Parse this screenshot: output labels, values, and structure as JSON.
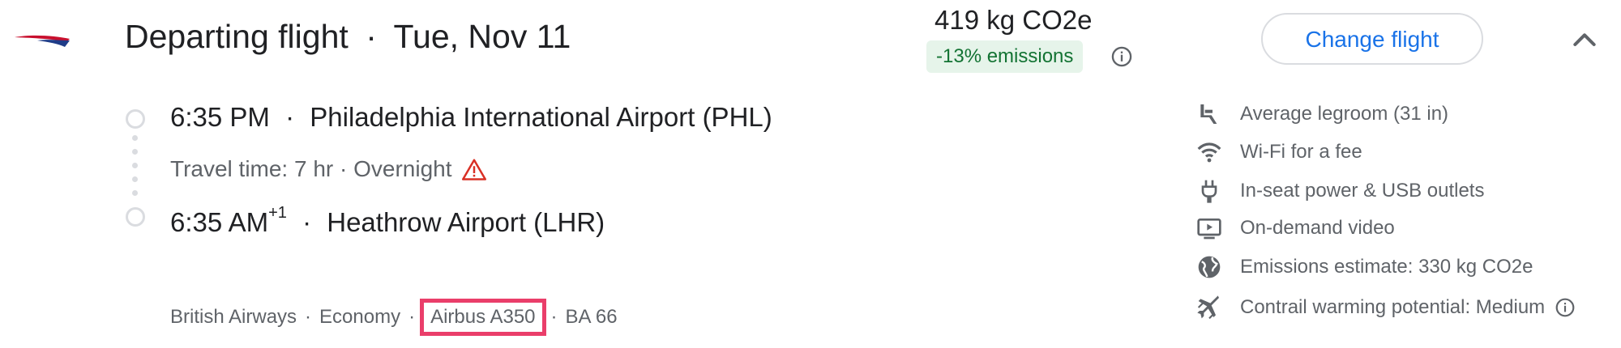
{
  "colors": {
    "accent": "#1a73e8",
    "emissions_bg": "#e6f4ea",
    "emissions_text": "#137333",
    "warning": "#d93025",
    "highlight": "#ea3e6a"
  },
  "header": {
    "title": "Departing flight",
    "separator": "·",
    "date": "Tue, Nov 11",
    "co2": "419 kg CO2e",
    "emissions_badge": "-13% emissions",
    "change_button": "Change flight",
    "airline_logo": "british-airways-logo",
    "collapse_icon": "chevron-up-icon"
  },
  "itinerary": {
    "depart_time": "6:35 PM",
    "depart_airport": "Philadelphia International Airport (PHL)",
    "travel_time": "Travel time: 7 hr · Overnight",
    "arrive_time": "6:35 AM",
    "arrive_day_offset": "+1",
    "arrive_airport": "Heathrow Airport (LHR)"
  },
  "details": {
    "airline": "British Airways",
    "cabin": "Economy",
    "aircraft": "Airbus A350",
    "flight_number": "BA 66",
    "sep": "·"
  },
  "amenities": [
    {
      "icon": "legroom-seat-icon",
      "label": "Average legroom (31 in)"
    },
    {
      "icon": "wifi-icon",
      "label": "Wi-Fi for a fee"
    },
    {
      "icon": "power-plug-icon",
      "label": "In-seat power & USB outlets"
    },
    {
      "icon": "video-icon",
      "label": "On-demand video"
    },
    {
      "icon": "globe-icon",
      "label": "Emissions estimate: 330 kg CO2e"
    },
    {
      "icon": "contrail-plane-icon",
      "label": "Contrail warming potential: Medium"
    }
  ]
}
